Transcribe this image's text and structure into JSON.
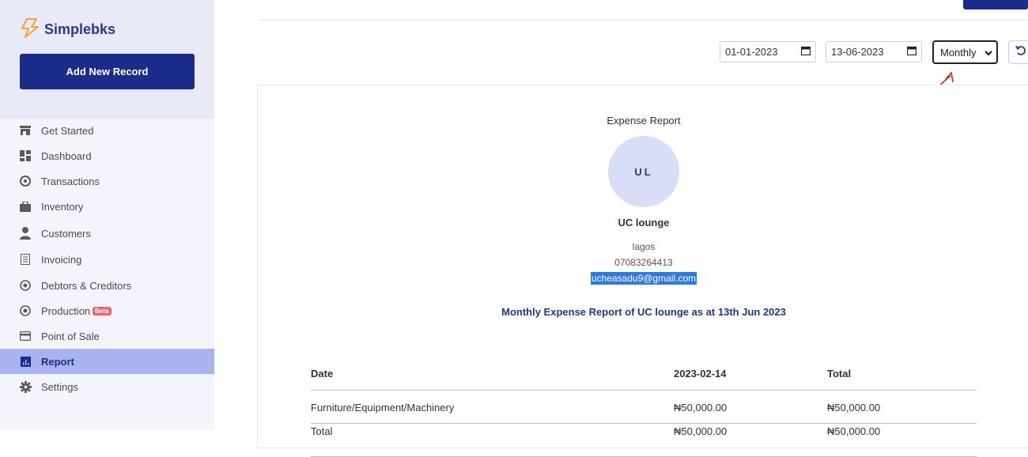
{
  "app": {
    "name": "Simplebks",
    "add_record_label": "Add New Record"
  },
  "sidebar": {
    "items": [
      {
        "label": "Get Started",
        "icon": "store-icon"
      },
      {
        "label": "Dashboard",
        "icon": "dashboard-icon"
      },
      {
        "label": "Transactions",
        "icon": "transactions-icon"
      },
      {
        "label": "Inventory",
        "icon": "briefcase-icon"
      },
      {
        "label": "Customers",
        "icon": "person-icon"
      },
      {
        "label": "Invoicing",
        "icon": "receipt-icon"
      },
      {
        "label": "Debtors & Creditors",
        "icon": "debtors-icon"
      },
      {
        "label": "Production",
        "icon": "production-icon",
        "badge": "Beta"
      },
      {
        "label": "Point of Sale",
        "icon": "card-icon"
      },
      {
        "label": "Report",
        "icon": "report-icon",
        "active": true
      },
      {
        "label": "Settings",
        "icon": "gear-icon"
      }
    ]
  },
  "filters": {
    "start_date": "01-01-2023",
    "end_date": "13-06-2023",
    "period": "Monthly"
  },
  "report": {
    "title": "Expense Report",
    "initials": "UL",
    "company": "UC lounge",
    "city": "lagos",
    "phone": "07083264413",
    "email": "ucheasadu9@gmail.com",
    "headline": "Monthly Expense Report of UC lounge as at 13th Jun 2023"
  },
  "table": {
    "headers": [
      "Date",
      "2023-02-14",
      "Total"
    ],
    "rows": [
      [
        "Furniture/Equipment/Machinery",
        "₦50,000.00",
        "₦50,000.00"
      ],
      [
        "Total",
        "₦50,000.00",
        "₦50,000.00"
      ]
    ]
  },
  "colors": {
    "brand": "#1b2c8a",
    "active_nav": "#a9b3ef",
    "annotation": "#e02020"
  }
}
